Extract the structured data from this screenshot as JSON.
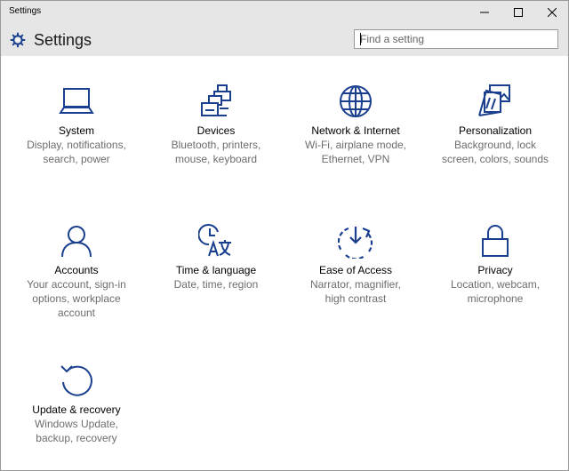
{
  "window": {
    "title": "Settings"
  },
  "header": {
    "heading": "Settings",
    "search_placeholder": "Find a setting"
  },
  "colors": {
    "accent": "#1a3f8f",
    "titlebar": "#e6e6e6"
  },
  "tiles": [
    {
      "label": "System",
      "description": "Display, notifications,\nsearch, power",
      "icon": "laptop-icon"
    },
    {
      "label": "Devices",
      "description": "Bluetooth, printers,\nmouse, keyboard",
      "icon": "devices-icon"
    },
    {
      "label": "Network & Internet",
      "description": "Wi-Fi, airplane mode,\nEthernet, VPN",
      "icon": "globe-icon"
    },
    {
      "label": "Personalization",
      "description": "Background, lock\nscreen, colors, sounds",
      "icon": "personalization-icon"
    },
    {
      "label": "Accounts",
      "description": "Your account, sign-in\noptions, workplace\naccount",
      "icon": "person-icon"
    },
    {
      "label": "Time & language",
      "description": "Date, time, region",
      "icon": "clock-language-icon"
    },
    {
      "label": "Ease of Access",
      "description": "Narrator, magnifier,\nhigh contrast",
      "icon": "ease-of-access-icon"
    },
    {
      "label": "Privacy",
      "description": "Location, webcam,\nmicrophone",
      "icon": "lock-icon"
    },
    {
      "label": "Update & recovery",
      "description": "Windows Update,\nbackup, recovery",
      "icon": "refresh-icon"
    }
  ]
}
